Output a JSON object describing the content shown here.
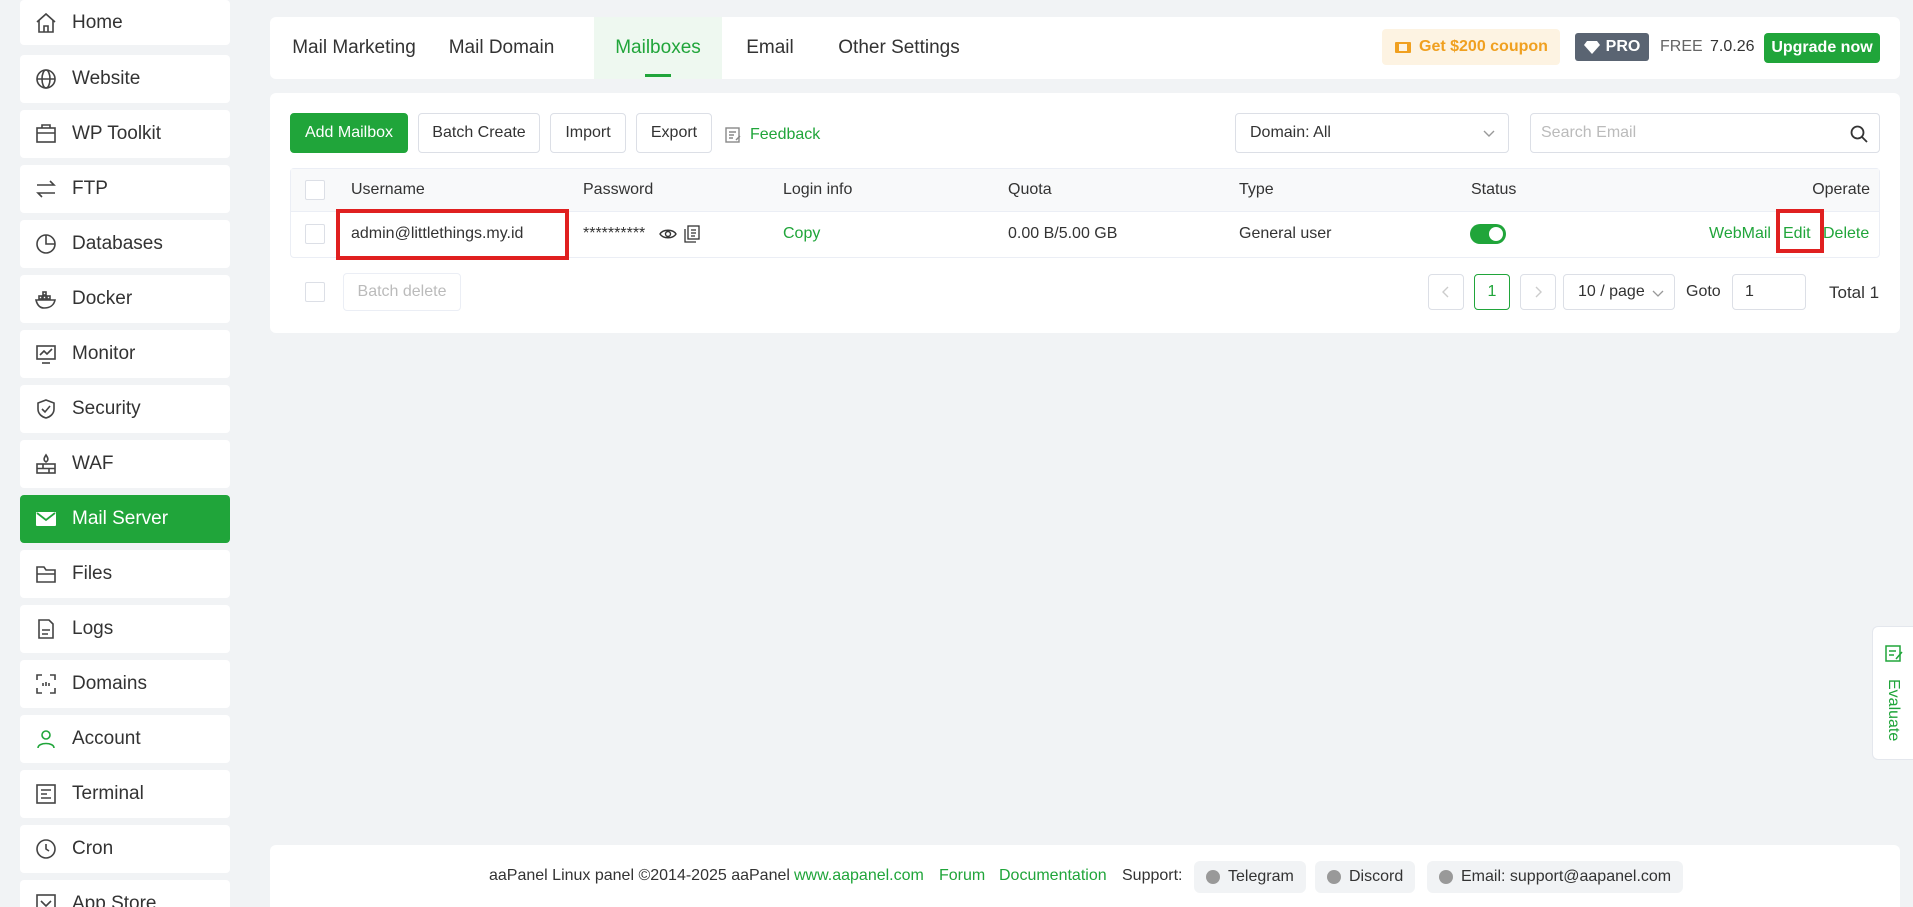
{
  "sidebar": {
    "items": [
      {
        "label": "Home",
        "icon": "home-icon"
      },
      {
        "label": "Website",
        "icon": "globe-icon"
      },
      {
        "label": "WP Toolkit",
        "icon": "toolkit-icon"
      },
      {
        "label": "FTP",
        "icon": "transfer-icon"
      },
      {
        "label": "Databases",
        "icon": "database-icon"
      },
      {
        "label": "Docker",
        "icon": "docker-icon"
      },
      {
        "label": "Monitor",
        "icon": "monitor-icon"
      },
      {
        "label": "Security",
        "icon": "shield-icon"
      },
      {
        "label": "WAF",
        "icon": "firewall-icon"
      },
      {
        "label": "Mail Server",
        "icon": "mail-icon",
        "active": true
      },
      {
        "label": "Files",
        "icon": "folder-icon"
      },
      {
        "label": "Logs",
        "icon": "logs-icon"
      },
      {
        "label": "Domains",
        "icon": "domains-icon"
      },
      {
        "label": "Account",
        "icon": "user-icon"
      },
      {
        "label": "Terminal",
        "icon": "terminal-icon"
      },
      {
        "label": "Cron",
        "icon": "clock-icon"
      },
      {
        "label": "App Store",
        "icon": "app-store-icon"
      }
    ]
  },
  "header": {
    "tabs": [
      {
        "label": "Mail Marketing"
      },
      {
        "label": "Mail Domain"
      },
      {
        "label": "Mailboxes",
        "active": true
      },
      {
        "label": "Email"
      },
      {
        "label": "Other Settings"
      }
    ],
    "coupon": "Get $200 coupon",
    "pro": "PRO",
    "free": "FREE",
    "version": "7.0.26",
    "upgrade": "Upgrade now"
  },
  "toolbar": {
    "add": "Add Mailbox",
    "batch_create": "Batch Create",
    "import": "Import",
    "export": "Export",
    "feedback": "Feedback",
    "domain_select": "Domain: All",
    "search_placeholder": "Search Email"
  },
  "table": {
    "columns": [
      "Username",
      "Password",
      "Login info",
      "Quota",
      "Type",
      "Status",
      "Operate"
    ],
    "rows": [
      {
        "username": "admin@littlethings.my.id",
        "password": "**********",
        "login_info": "Copy",
        "quota": "0.00 B/5.00 GB",
        "type": "General user",
        "status": true,
        "actions": {
          "webmail": "WebMail",
          "edit": "Edit",
          "delete": "Delete"
        }
      }
    ]
  },
  "pagination": {
    "batch_delete": "Batch delete",
    "page": "1",
    "per_page": "10 / page",
    "goto_label": "Goto",
    "goto_value": "1",
    "total": "Total 1"
  },
  "footer": {
    "copyright": "aaPanel Linux panel ©2014-2025 aaPanel",
    "site": "www.aapanel.com",
    "forum": "Forum",
    "docs": "Documentation",
    "support_label": "Support:",
    "telegram": "Telegram",
    "discord": "Discord",
    "email": "Email: support@aapanel.com"
  },
  "evaluate": "Evaluate",
  "colors": {
    "brand": "#20a53a",
    "highlight": "#e02020",
    "coupon": "#f0a020"
  }
}
